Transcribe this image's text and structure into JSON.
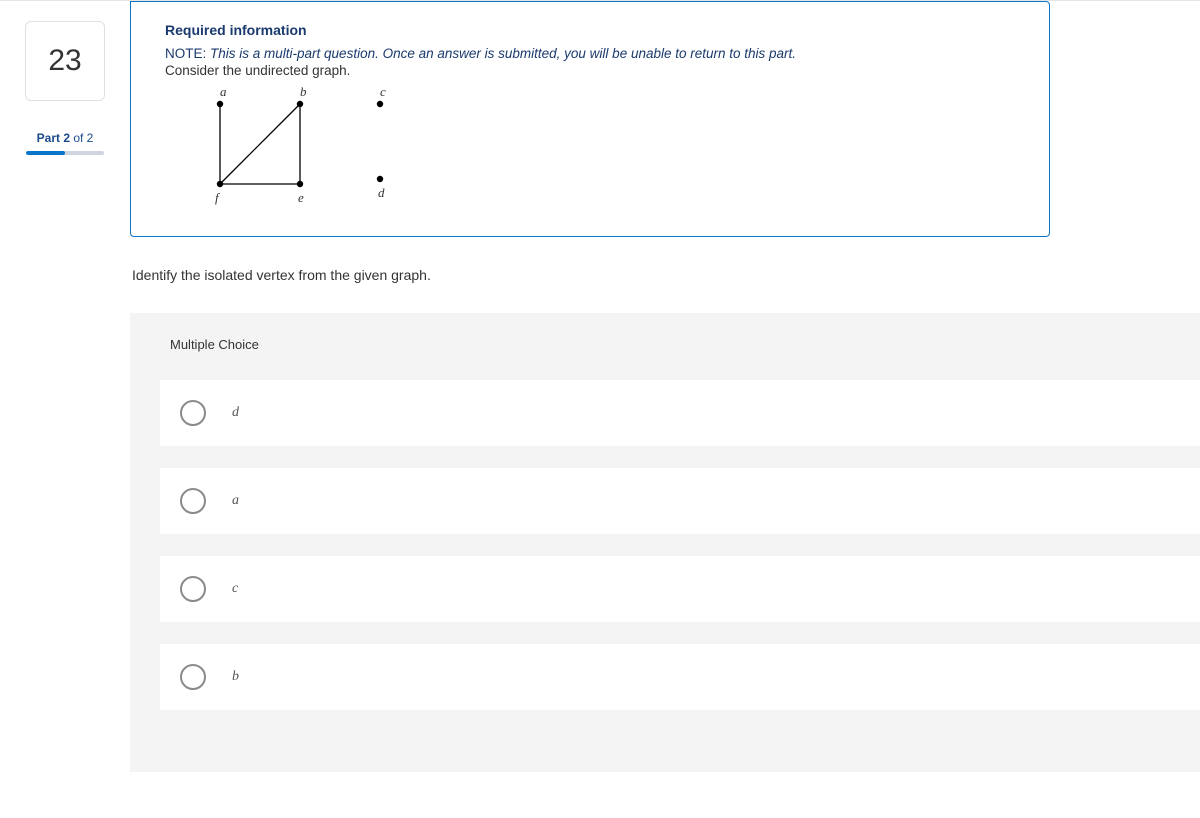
{
  "question_number": "23",
  "part_indicator": {
    "prefix": "Part 2",
    "suffix": " of 2"
  },
  "info": {
    "title": "Required information",
    "note_label": "NOTE: ",
    "note_text": "This is a multi-part question. Once an answer is submitted, you will be unable to return to this part.",
    "consider": "Consider the undirected graph."
  },
  "graph": {
    "vertices": [
      "a",
      "b",
      "c",
      "d",
      "e",
      "f"
    ]
  },
  "stem": "Identify the isolated vertex from the given graph.",
  "mc_heading": "Multiple Choice",
  "choices": [
    {
      "label": "d"
    },
    {
      "label": "a"
    },
    {
      "label": "c"
    },
    {
      "label": "b"
    }
  ]
}
